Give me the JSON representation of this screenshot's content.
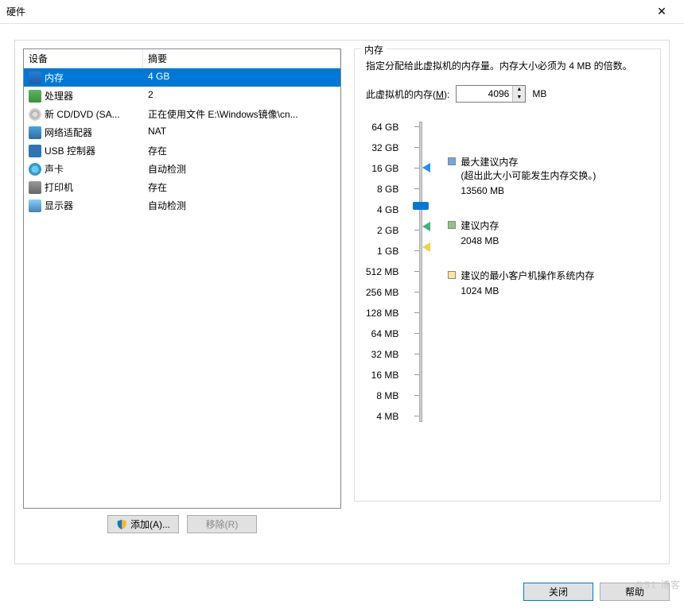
{
  "title": "硬件",
  "columns": {
    "device": "设备",
    "summary": "摘要"
  },
  "hardware": [
    {
      "name": "内存",
      "summary": "4 GB",
      "icon": "mem",
      "selected": true
    },
    {
      "name": "处理器",
      "summary": "2",
      "icon": "cpu"
    },
    {
      "name": "新 CD/DVD (SA...",
      "summary": "正在使用文件 E:\\Windows镜像\\cn...",
      "icon": "cd"
    },
    {
      "name": "网络适配器",
      "summary": "NAT",
      "icon": "net"
    },
    {
      "name": "USB 控制器",
      "summary": "存在",
      "icon": "usb"
    },
    {
      "name": "声卡",
      "summary": "自动检测",
      "icon": "snd"
    },
    {
      "name": "打印机",
      "summary": "存在",
      "icon": "prn"
    },
    {
      "name": "显示器",
      "summary": "自动检测",
      "icon": "dsp"
    }
  ],
  "buttons": {
    "add": "添加(A)...",
    "remove": "移除(R)",
    "close": "关闭",
    "help": "帮助"
  },
  "memory": {
    "group_title": "内存",
    "desc": "指定分配给此虚拟机的内存量。内存大小必须为 4 MB 的倍数。",
    "label_prefix": "此虚拟机的内存(",
    "label_hotkey": "M",
    "label_suffix": "):",
    "value": "4096",
    "unit": "MB",
    "ticks": [
      "64 GB",
      "32 GB",
      "16 GB",
      "8 GB",
      "4 GB",
      "2 GB",
      "1 GB",
      "512 MB",
      "256 MB",
      "128 MB",
      "64 MB",
      "32 MB",
      "16 MB",
      "8 MB",
      "4 MB"
    ],
    "legend": {
      "max": {
        "title": "最大建议内存",
        "sub1": "(超出此大小可能发生内存交换。)",
        "sub2": "13560 MB"
      },
      "rec": {
        "title": "建议内存",
        "sub": "2048 MB"
      },
      "min": {
        "title": "建议的最小客户机操作系统内存",
        "sub": "1024 MB"
      }
    }
  },
  "watermark": "@51   博客"
}
